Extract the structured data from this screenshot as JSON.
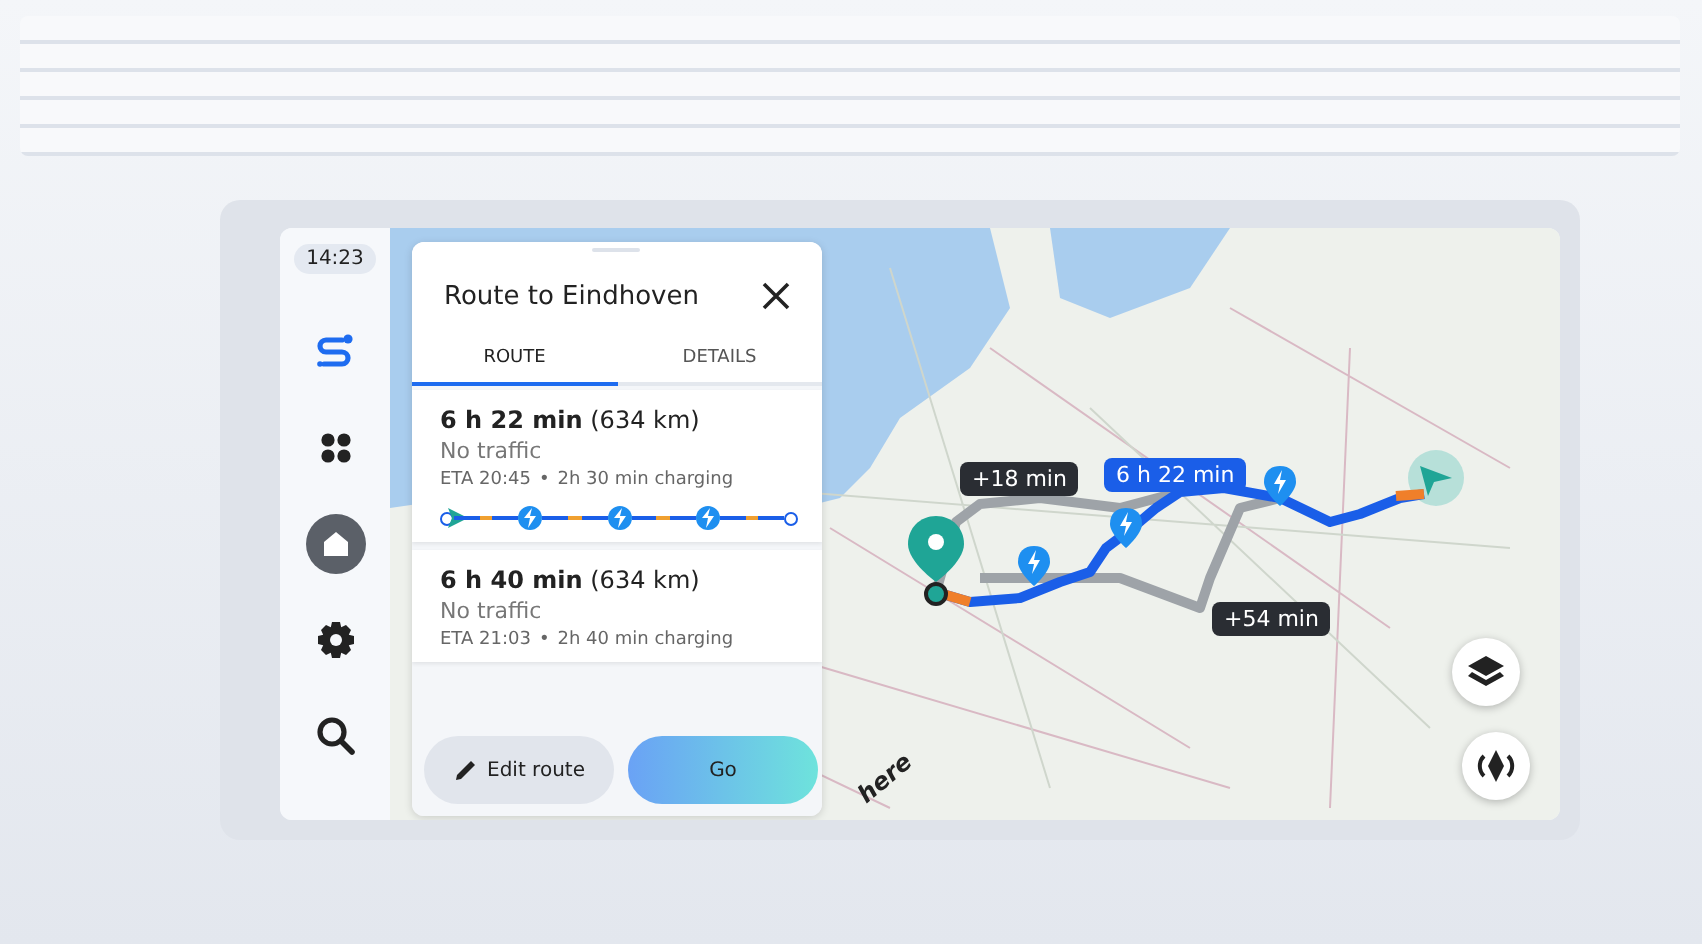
{
  "status": {
    "time": "14:23"
  },
  "sidebar": {
    "items": [
      {
        "kind": "logo",
        "selected": false
      },
      {
        "kind": "apps",
        "selected": false
      },
      {
        "kind": "home",
        "selected": true
      },
      {
        "kind": "settings",
        "selected": false
      },
      {
        "kind": "search",
        "selected": false
      }
    ]
  },
  "panel": {
    "title": "Route to Eindhoven",
    "tabs": [
      {
        "label": "ROUTE",
        "selected": true
      },
      {
        "label": "DETAILS",
        "selected": false
      }
    ],
    "routes": [
      {
        "duration": "6 h 22 min",
        "distance": "(634 km)",
        "traffic": "No traffic",
        "eta": "ETA 20:45",
        "separator": "•",
        "charging": "2h 30 min charging",
        "strip": [
          {
            "kind": "start"
          },
          {
            "kind": "charge"
          },
          {
            "kind": "charge"
          },
          {
            "kind": "charge"
          },
          {
            "kind": "end"
          }
        ]
      },
      {
        "duration": "6 h 40 min",
        "distance": "(634 km)",
        "traffic": "No traffic",
        "eta": "ETA 21:03",
        "separator": "•",
        "charging": "2h 40 min charging"
      }
    ],
    "buttons": [
      {
        "kind": "edit",
        "label": "Edit route"
      },
      {
        "kind": "go",
        "label": "Go"
      }
    ]
  },
  "map": {
    "labels": [
      {
        "kind": "alternative",
        "text": "+18 min"
      },
      {
        "kind": "main",
        "text": "6 h 22 min"
      },
      {
        "kind": "alternative",
        "text": "+54 min"
      }
    ],
    "logo": "here"
  }
}
